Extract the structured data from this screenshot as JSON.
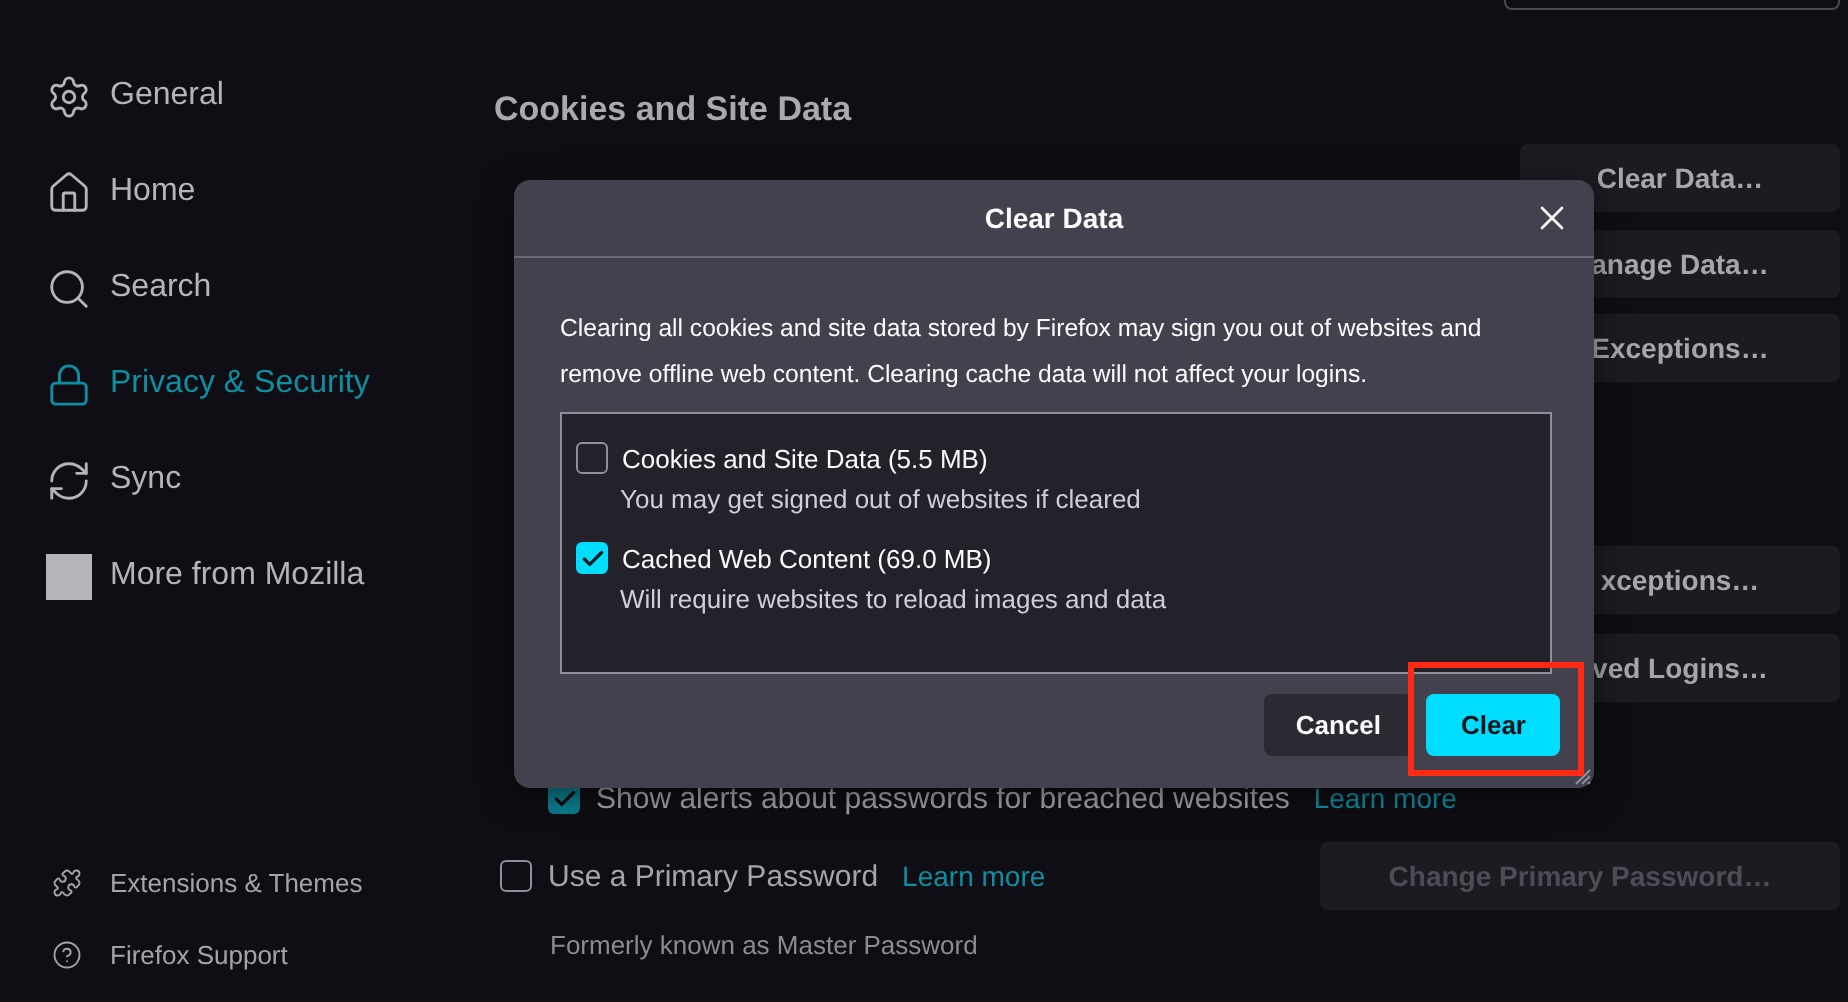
{
  "sidebar": {
    "items": [
      {
        "label": "General",
        "selected": false
      },
      {
        "label": "Home",
        "selected": false
      },
      {
        "label": "Search",
        "selected": false
      },
      {
        "label": "Privacy & Security",
        "selected": true
      },
      {
        "label": "Sync",
        "selected": false
      },
      {
        "label": "More from Mozilla",
        "selected": false
      }
    ],
    "footer": [
      {
        "label": "Extensions & Themes"
      },
      {
        "label": "Firefox Support"
      }
    ]
  },
  "content": {
    "heading": "Cookies and Site Data",
    "rows": [
      {
        "kind": "button_only",
        "button": "Clear Data…"
      },
      {
        "kind": "button_only",
        "button": "anage Data…"
      },
      {
        "kind": "button_only",
        "button": "Exceptions…"
      },
      {
        "kind": "spacer"
      },
      {
        "kind": "button_only",
        "button": "xceptions…"
      },
      {
        "kind": "button_only",
        "button": "ved Logins…"
      },
      {
        "kind": "sub_option",
        "checked": true,
        "text": "Show alerts about passwords for breached websites",
        "link": "Learn more"
      },
      {
        "kind": "option",
        "checked": false,
        "text": "Use a Primary Password",
        "link": "Learn more",
        "button": "Change Primary Password…",
        "button_disabled": true
      },
      {
        "kind": "note",
        "text": "Formerly known as Master Password"
      }
    ]
  },
  "dialog": {
    "title": "Clear Data",
    "description": "Clearing all cookies and site data stored by Firefox may sign you out of websites and remove offline web content. Clearing cache data will not affect your logins.",
    "options": [
      {
        "label": "Cookies and Site Data (5.5 MB)",
        "hint": "You may get signed out of websites if cleared",
        "checked": false
      },
      {
        "label": "Cached Web Content (69.0 MB)",
        "hint": "Will require websites to reload images and data",
        "checked": true
      }
    ],
    "buttons": [
      {
        "label": "Cancel",
        "primary": false
      },
      {
        "label": "Clear",
        "primary": true,
        "highlighted": true
      }
    ]
  }
}
